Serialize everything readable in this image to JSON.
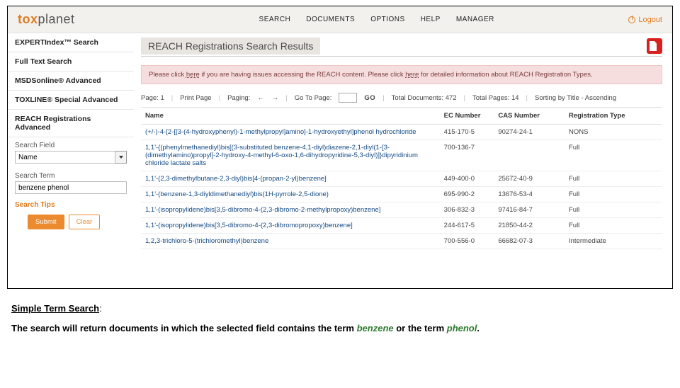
{
  "brand": {
    "left": "tox",
    "right": "planet"
  },
  "nav": {
    "items": [
      "SEARCH",
      "DOCUMENTS",
      "OPTIONS",
      "HELP",
      "MANAGER"
    ],
    "logout": "Logout"
  },
  "sidebar": {
    "items": [
      "EXPERTIndex™ Search",
      "Full Text Search",
      "MSDSonline® Advanced",
      "TOXLINE® Special Advanced",
      "REACH Registrations Advanced"
    ],
    "field_label": "Search Field",
    "field_value": "Name",
    "term_label": "Search Term",
    "term_value": "benzene phenol",
    "tips": "Search Tips",
    "submit": "Submit",
    "clear": "Clear"
  },
  "page": {
    "title": "REACH Registrations Search Results",
    "alert_pre": "Please click ",
    "alert_here1": "here",
    "alert_mid": " if you are having issues accessing the REACH content. Please click ",
    "alert_here2": "here",
    "alert_post": " for detailed information about REACH Registration Types.",
    "pager": {
      "page": "Page: 1",
      "print": "Print Page",
      "paging": "Paging:",
      "goto": "Go To Page:",
      "go": "GO",
      "total_docs": "Total Documents: 472",
      "total_pages": "Total Pages: 14",
      "sort": "Sorting by Title - Ascending"
    },
    "cols": {
      "name": "Name",
      "ec": "EC Number",
      "cas": "CAS Number",
      "reg": "Registration Type"
    },
    "rows": [
      {
        "name": "(+/-)-4-[2-[[3-(4-hydroxyphenyl)-1-methylpropyl]amino]-1-hydroxyethyl]phenol hydrochloride",
        "ec": "415-170-5",
        "cas": "90274-24-1",
        "reg": "NONS"
      },
      {
        "name": "1,1'-{(phenylmethanediyl)bis[(3-substituted benzene-4,1-diyl)diazene-2,1-diyl(1-[3-(dimethylamino)propyl]-2-hydroxy-4-methyl-6-oxo-1,6-dihydropyridine-5,3-diyl)]}dipyridinium chloride lactate salts",
        "ec": "700-136-7",
        "cas": "",
        "reg": "Full"
      },
      {
        "name": "1,1'-(2,3-dimethylbutane-2,3-diyl)bis[4-(propan-2-yl)benzene]",
        "ec": "449-400-0",
        "cas": "25672-40-9",
        "reg": "Full"
      },
      {
        "name": "1,1'-(benzene-1,3-diyldimethanediyl)bis(1H-pyrrole-2,5-dione)",
        "ec": "695-990-2",
        "cas": "13676-53-4",
        "reg": "Full"
      },
      {
        "name": "1,1'-(isopropylidene)bis[3,5-dibromo-4-(2,3-dibromo-2-methylpropoxy)benzene]",
        "ec": "306-832-3",
        "cas": "97416-84-7",
        "reg": "Full"
      },
      {
        "name": "1,1'-(isopropylidene)bis[3,5-dibromo-4-(2,3-dibromopropoxy)benzene]",
        "ec": "244-617-5",
        "cas": "21850-44-2",
        "reg": "Full"
      },
      {
        "name": "1,2,3-trichloro-5-(trichloromethyl)benzene",
        "ec": "700-556-0",
        "cas": "66682-07-3",
        "reg": "Intermediate"
      }
    ]
  },
  "caption": {
    "title": "Simple Term Search",
    "line_pre": "The search will return documents in which the selected field contains the term ",
    "term1": "benzene",
    "mid": " or the term ",
    "term2": "phenol",
    "post": "."
  }
}
